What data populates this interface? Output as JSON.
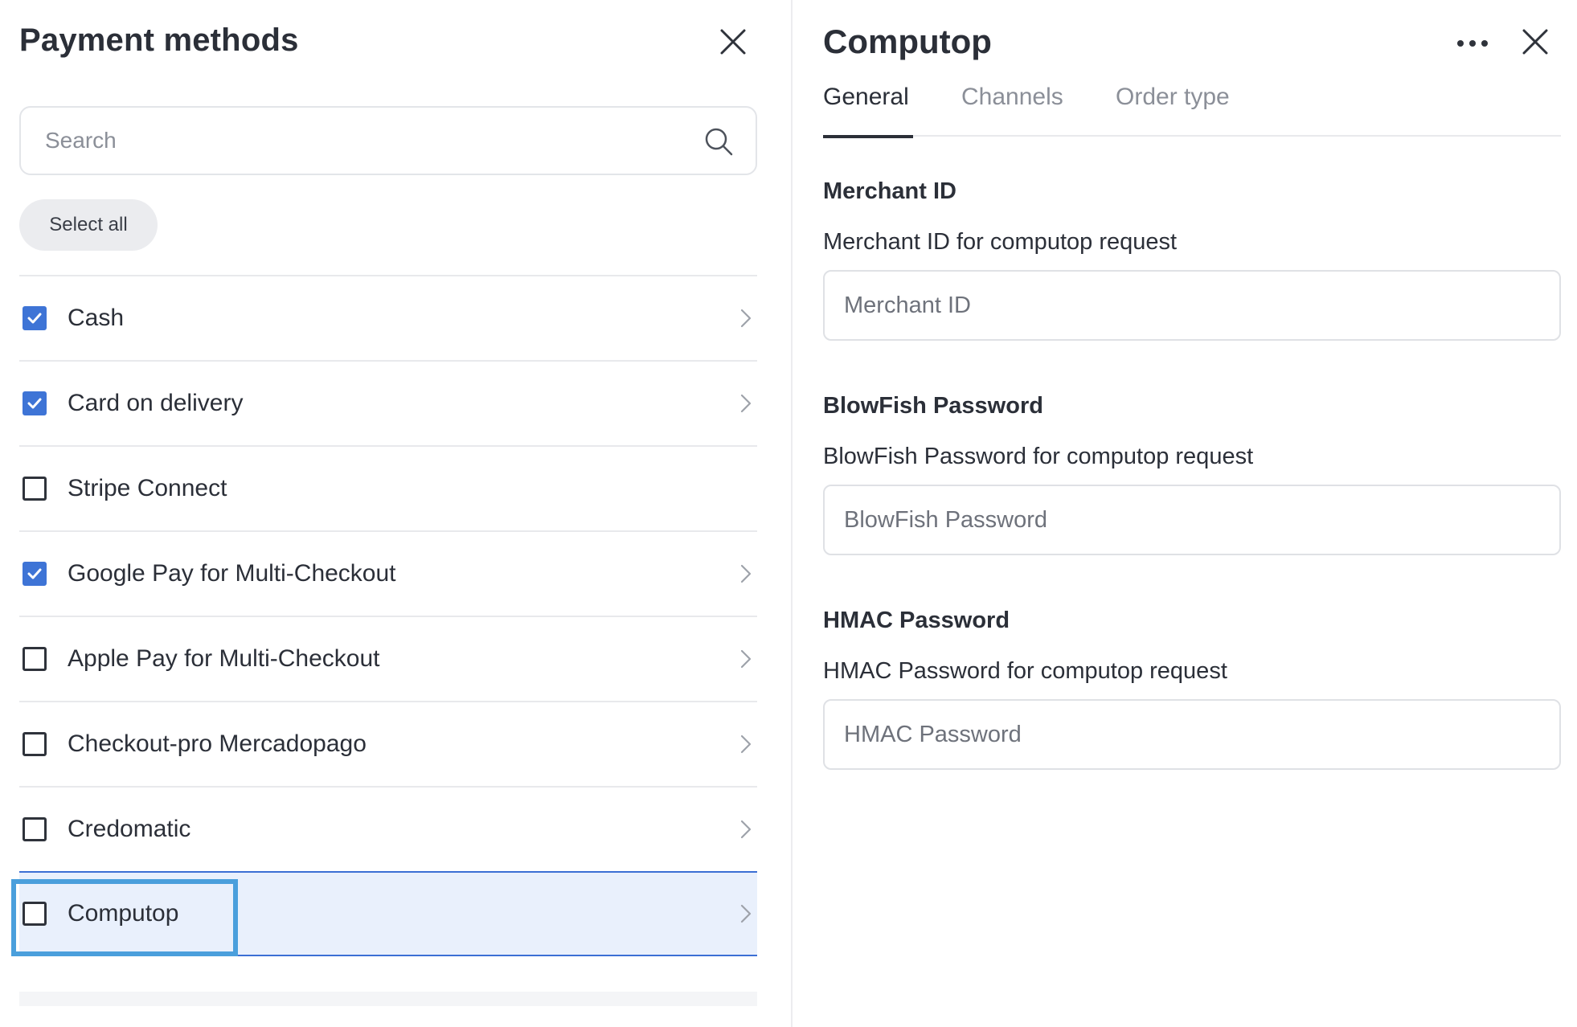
{
  "left_panel": {
    "title": "Payment methods",
    "search": {
      "placeholder": "Search",
      "value": ""
    },
    "select_all_label": "Select all",
    "methods": [
      {
        "label": "Cash",
        "checked": true,
        "has_chevron": true,
        "selected": false
      },
      {
        "label": "Card on delivery",
        "checked": true,
        "has_chevron": true,
        "selected": false
      },
      {
        "label": "Stripe Connect",
        "checked": false,
        "has_chevron": false,
        "selected": false
      },
      {
        "label": "Google Pay for Multi-Checkout",
        "checked": true,
        "has_chevron": true,
        "selected": false
      },
      {
        "label": "Apple Pay for Multi-Checkout",
        "checked": false,
        "has_chevron": true,
        "selected": false
      },
      {
        "label": "Checkout-pro Mercadopago",
        "checked": false,
        "has_chevron": true,
        "selected": false
      },
      {
        "label": "Credomatic",
        "checked": false,
        "has_chevron": true,
        "selected": false
      },
      {
        "label": "Computop",
        "checked": false,
        "has_chevron": true,
        "selected": true
      }
    ]
  },
  "right_panel": {
    "title": "Computop",
    "tabs": [
      {
        "label": "General",
        "active": true
      },
      {
        "label": "Channels",
        "active": false
      },
      {
        "label": "Order type",
        "active": false
      }
    ],
    "fields": [
      {
        "heading": "Merchant ID",
        "description": "Merchant ID for computop request",
        "placeholder": "Merchant ID",
        "value": ""
      },
      {
        "heading": "BlowFish Password",
        "description": "BlowFish Password for computop request",
        "placeholder": "BlowFish Password",
        "value": ""
      },
      {
        "heading": "HMAC Password",
        "description": "HMAC Password for computop request",
        "placeholder": "HMAC Password",
        "value": ""
      }
    ]
  },
  "colors": {
    "checkbox_checked": "#3e74d6",
    "selected_row_bg": "#e9f0fc",
    "selected_row_border": "#3b6fd4",
    "highlight_outline": "#4a9fdc",
    "text_primary": "#2b2f38",
    "text_muted": "#8b8f98"
  },
  "icons": {
    "close": "close-icon",
    "search": "search-icon",
    "chevron": "chevron-right-icon",
    "check": "check-icon",
    "more": "more-horizontal-icon"
  }
}
